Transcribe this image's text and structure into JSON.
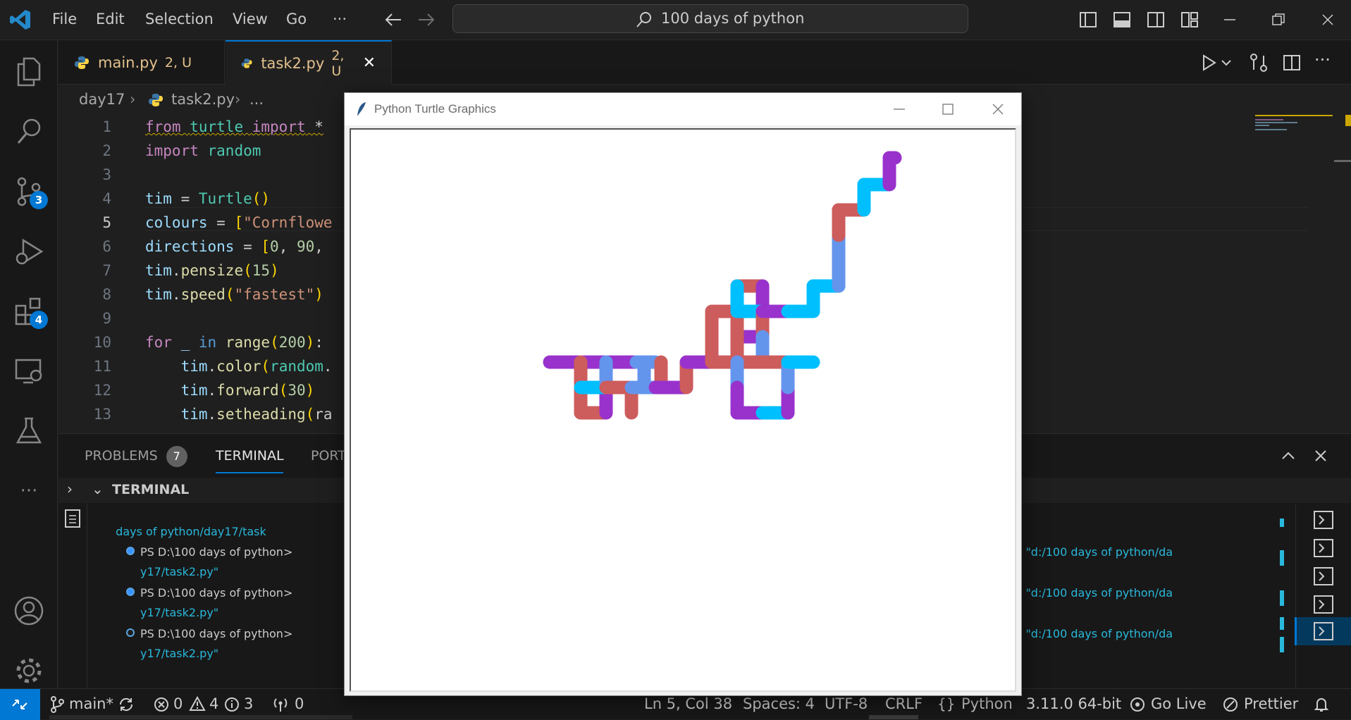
{
  "titlebar": {
    "menus": [
      "File",
      "Edit",
      "Selection",
      "View",
      "Go",
      "···"
    ],
    "search_text": "100 days of python"
  },
  "activity": {
    "source_control_badge": "3",
    "extensions_badge": "4"
  },
  "tabs": [
    {
      "name": "main.py",
      "status": "2, U",
      "active": false
    },
    {
      "name": "task2.py",
      "status": "2, U",
      "active": true
    }
  ],
  "breadcrumb": {
    "folder": "day17",
    "file": "task2.py",
    "more": "..."
  },
  "editor": {
    "line_numbers": [
      "1",
      "2",
      "3",
      "4",
      "5",
      "6",
      "7",
      "8",
      "9",
      "10",
      "11",
      "12",
      "13"
    ],
    "lines": [
      "from turtle import *",
      "import random",
      "",
      "tim = Turtle()",
      "colours = [\"Cornflowe",
      "directions = [0, 90,",
      "tim.pensize(15)",
      "tim.speed(\"fastest\")",
      "",
      "for _ in range(200):",
      "    tim.color(random.",
      "    tim.forward(30)",
      "    tim.setheading(ra"
    ]
  },
  "panel": {
    "tabs": {
      "problems": "PROBLEMS",
      "problems_count": "7",
      "terminal": "TERMINAL",
      "ports": "PORT"
    },
    "terminal_header": "TERMINAL",
    "lines": {
      "l0": "  days of python/day17/task",
      "l1": "PS D:\\100 days of python>",
      "l1b": "\" \"d:/100 days of python/da",
      "l2": "y17/task2.py\"",
      "l3": "PS D:\\100 days of python>",
      "l3b": "\" \"d:/100 days of python/da",
      "l4": "y17/task2.py\"",
      "l5": "PS D:\\100 days of python>",
      "l5b": "\" \"d:/100 days of python/da",
      "l6": "y17/task2.py\""
    }
  },
  "statusbar": {
    "branch": "main*",
    "errors": "0",
    "warnings": "4",
    "info": "3",
    "ports": "0",
    "position": "Ln 5, Col 38",
    "spaces": "Spaces: 4",
    "encoding": "UTF-8",
    "eol": "CRLF",
    "language": "Python",
    "interpreter": "3.11.0 64-bit",
    "golive": "Go Live",
    "prettier": "Prettier"
  },
  "turtle_window": {
    "title": "Python Turtle Graphics",
    "colors": {
      "cornflowerblue": "#6495ed",
      "indianred": "#cd5c5c",
      "darkorchid": "#9932cc",
      "deepskyblue": "#00bfff"
    }
  }
}
